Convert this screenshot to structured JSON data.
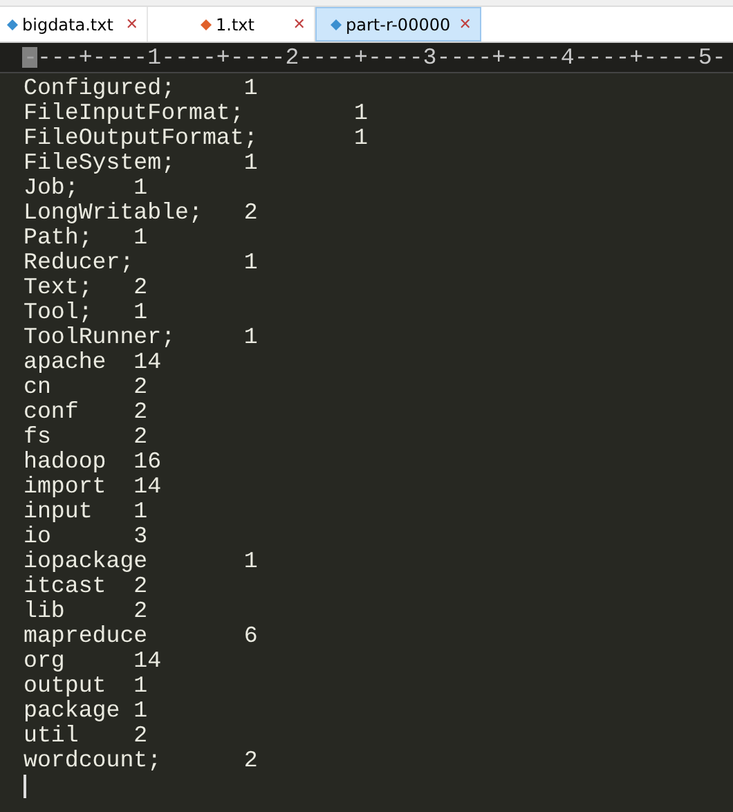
{
  "tabs": [
    {
      "label": "bigdata.txt",
      "selected": false,
      "color": "#3a8fd0"
    },
    {
      "label": "1.txt",
      "selected": false,
      "color": "#e0602a"
    },
    {
      "label": "part-r-00000",
      "selected": true,
      "color": "#3a8fd0"
    }
  ],
  "close_glyph": "✕",
  "ruler": "----+----1----+----2----+----3----+----4----+----5-",
  "lines": [
    {
      "word": "Configured;",
      "count": "1"
    },
    {
      "word": "FileInputFormat;",
      "count": "1"
    },
    {
      "word": "FileOutputFormat;",
      "count": "1"
    },
    {
      "word": "FileSystem;",
      "count": "1"
    },
    {
      "word": "Job;",
      "count": "1"
    },
    {
      "word": "LongWritable;",
      "count": "2"
    },
    {
      "word": "Path;",
      "count": "1"
    },
    {
      "word": "Reducer;",
      "count": "1"
    },
    {
      "word": "Text;",
      "count": "2"
    },
    {
      "word": "Tool;",
      "count": "1"
    },
    {
      "word": "ToolRunner;",
      "count": "1"
    },
    {
      "word": "apache",
      "count": "14"
    },
    {
      "word": "cn",
      "count": "2"
    },
    {
      "word": "conf",
      "count": "2"
    },
    {
      "word": "fs",
      "count": "2"
    },
    {
      "word": "hadoop",
      "count": "16"
    },
    {
      "word": "import",
      "count": "14"
    },
    {
      "word": "input",
      "count": "1"
    },
    {
      "word": "io",
      "count": "3"
    },
    {
      "word": "iopackage",
      "count": "1"
    },
    {
      "word": "itcast",
      "count": "2"
    },
    {
      "word": "lib",
      "count": "2"
    },
    {
      "word": "mapreduce",
      "count": "6"
    },
    {
      "word": "org",
      "count": "14"
    },
    {
      "word": "output",
      "count": "1"
    },
    {
      "word": "package",
      "count": "1"
    },
    {
      "word": "util",
      "count": "2"
    },
    {
      "word": "wordcount;",
      "count": "2"
    }
  ]
}
